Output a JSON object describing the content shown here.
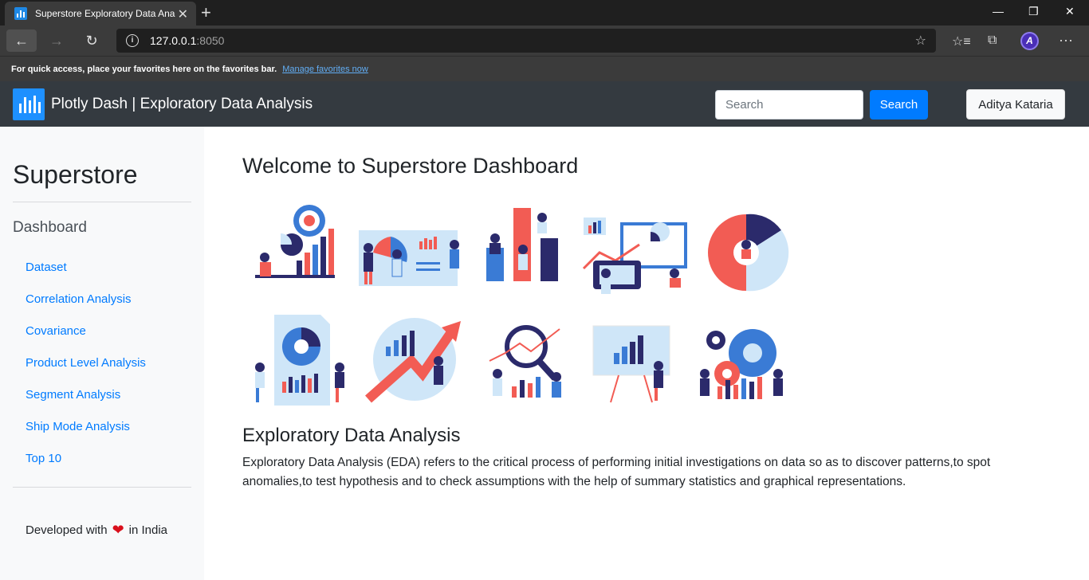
{
  "browser": {
    "tab_title": "Superstore Exploratory Data Ana",
    "url_host": "127.0.0.1",
    "url_port": ":8050",
    "profile_initial": "A",
    "favbar_text": "For quick access, place your favorites here on the favorites bar.",
    "favbar_link": "Manage favorites now"
  },
  "navbar": {
    "brand": "Plotly Dash | Exploratory Data Analysis",
    "search_placeholder": "Search",
    "search_button": "Search",
    "user": "Aditya Kataria"
  },
  "sidebar": {
    "title": "Superstore",
    "subtitle": "Dashboard",
    "links": [
      {
        "label": "Dataset"
      },
      {
        "label": "Correlation Analysis"
      },
      {
        "label": "Covariance"
      },
      {
        "label": "Product Level Analysis"
      },
      {
        "label": "Segment Analysis"
      },
      {
        "label": "Ship Mode Analysis"
      },
      {
        "label": "Top 10"
      }
    ],
    "footer_before": "Developed with",
    "footer_after": "in India"
  },
  "main": {
    "title": "Welcome to Superstore Dashboard",
    "heading": "Exploratory Data Analysis",
    "text": "Exploratory Data Analysis (EDA) refers to the critical process of performing initial investigations on data so as to discover patterns,to spot anomalies,to test hypothesis and to check assumptions with the help of summary statistics and graphical representations."
  },
  "colors": {
    "accent": "#007bff",
    "navbar": "#343a40",
    "sidebar": "#f8f9fa",
    "illustration_red": "#f25c54",
    "illustration_navy": "#2b2a6b",
    "illustration_blue": "#3a7bd5",
    "illustration_light": "#cfe6f8"
  }
}
